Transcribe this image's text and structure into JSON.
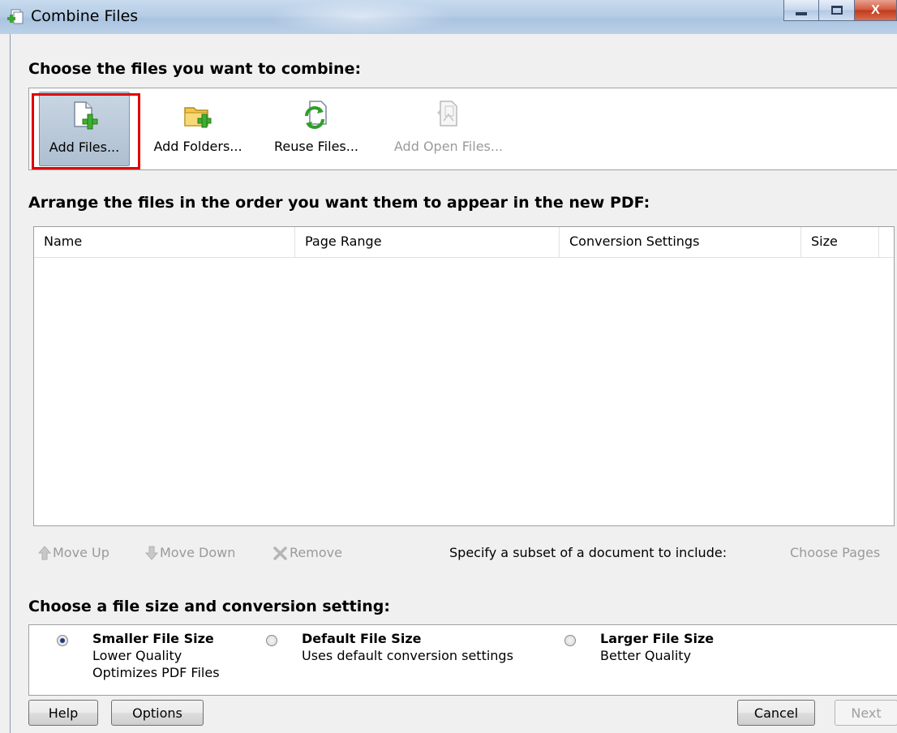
{
  "window": {
    "title": "Combine Files",
    "close_glyph": "X"
  },
  "sections": {
    "choose_files": "Choose the files you want to combine:",
    "arrange": "Arrange the files in the order you want them to appear in the new PDF:",
    "file_size": "Choose a file size and conversion setting:"
  },
  "toolbar": {
    "add_files": {
      "label": "Add Files...",
      "icon": "add-file-icon",
      "selected": true
    },
    "add_folders": {
      "label": "Add Folders...",
      "icon": "add-folder-icon"
    },
    "reuse_files": {
      "label": "Reuse Files...",
      "icon": "reuse-files-icon"
    },
    "add_open_files": {
      "label": "Add Open Files...",
      "icon": "add-open-files-icon",
      "disabled": true
    }
  },
  "file_list": {
    "columns": [
      "Name",
      "Page Range",
      "Conversion Settings",
      "Size"
    ],
    "rows": []
  },
  "list_actions": {
    "move_up": "Move Up",
    "move_down": "Move Down",
    "remove": "Remove",
    "subset_label": "Specify a subset of a document to include:",
    "choose_pages": "Choose Pages"
  },
  "size_options": [
    {
      "title": "Smaller File Size",
      "lines": [
        "Lower Quality",
        "Optimizes PDF Files"
      ],
      "checked": true
    },
    {
      "title": "Default File Size",
      "lines": [
        "Uses default conversion settings"
      ],
      "checked": false
    },
    {
      "title": "Larger File Size",
      "lines": [
        "Better Quality"
      ],
      "checked": false
    }
  ],
  "buttons": {
    "help": "Help",
    "options": "Options",
    "cancel": "Cancel",
    "next": "Next"
  },
  "colors": {
    "highlight": "#e00000",
    "disabled_text": "#9a9a9a"
  }
}
